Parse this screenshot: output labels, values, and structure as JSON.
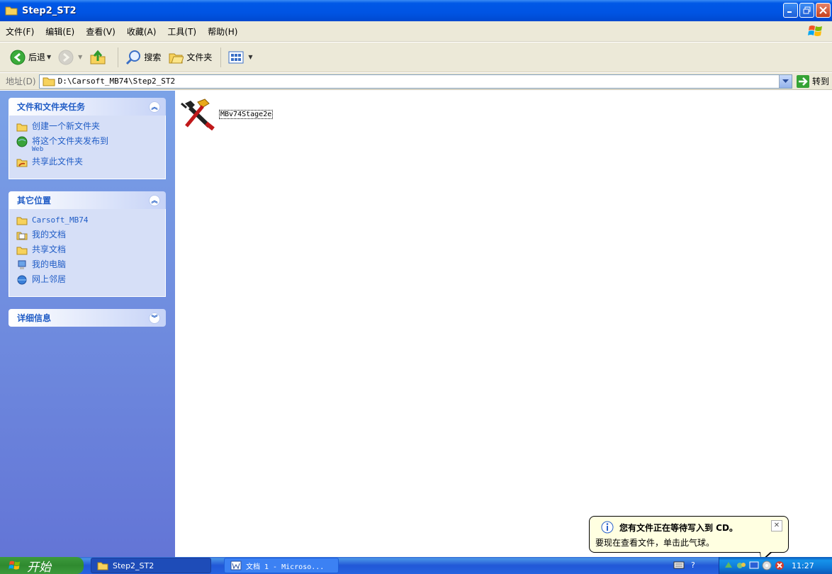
{
  "window": {
    "title": "Step2_ST2"
  },
  "menubar": {
    "items": [
      "文件(F)",
      "编辑(E)",
      "查看(V)",
      "收藏(A)",
      "工具(T)",
      "帮助(H)"
    ]
  },
  "toolbar": {
    "back_label": "后退",
    "search_label": "搜索",
    "folders_label": "文件夹"
  },
  "addressbar": {
    "label": "地址(D)",
    "value": "D:\\Carsoft_MB74\\Step2_ST2",
    "go_label": "转到"
  },
  "tasks": {
    "file_tasks": {
      "title": "文件和文件夹任务",
      "items": [
        {
          "label": "创建一个新文件夹",
          "icon": "new-folder-icon"
        },
        {
          "label": "将这个文件夹发布到",
          "sub": "Web",
          "icon": "publish-web-icon"
        },
        {
          "label": "共享此文件夹",
          "icon": "share-folder-icon"
        }
      ]
    },
    "other_places": {
      "title": "其它位置",
      "items": [
        {
          "label": "Carsoft_MB74",
          "icon": "folder-icon"
        },
        {
          "label": "我的文档",
          "icon": "my-documents-icon"
        },
        {
          "label": "共享文档",
          "icon": "shared-documents-icon"
        },
        {
          "label": "我的电脑",
          "icon": "my-computer-icon"
        },
        {
          "label": "网上邻居",
          "icon": "network-places-icon"
        }
      ]
    },
    "details": {
      "title": "详细信息"
    }
  },
  "files": [
    {
      "name": "MBv74Stage2e",
      "icon": "setup-tools-icon"
    }
  ],
  "balloon": {
    "title": "您有文件正在等待写入到 CD。",
    "text": "要现在查看文件，单击此气球。"
  },
  "taskbar": {
    "start_label": "开始",
    "tasks": [
      {
        "label": "Step2_ST2",
        "active": true
      },
      {
        "label": "文档 1 - Microso...",
        "active": false
      }
    ],
    "clock": "11:27"
  },
  "colors": {
    "titlebar": "#0054e3",
    "task_pane_link": "#215dc6",
    "task_pane_bg": "#6375d6",
    "balloon_bg": "#ffffe1"
  }
}
